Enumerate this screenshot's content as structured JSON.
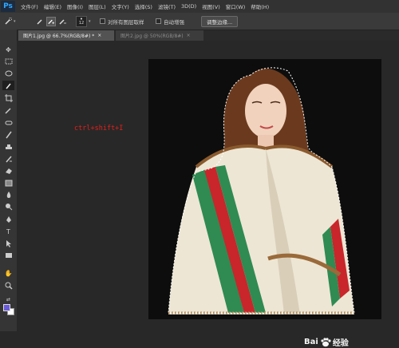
{
  "menubar": {
    "logo": "Ps",
    "items": [
      "文件(F)",
      "编辑(E)",
      "图像(I)",
      "图层(L)",
      "文字(Y)",
      "选择(S)",
      "滤镜(T)",
      "3D(D)",
      "视图(V)",
      "窗口(W)",
      "帮助(H)"
    ]
  },
  "options": {
    "brush_size": "12",
    "sample_all_layers_label": "对所有图层取样",
    "auto_enhance_label": "自动增强",
    "refine_edge_button": "调整边缘..."
  },
  "tabs": [
    {
      "label": "图片1.jpg @ 66.7%(RGB/8#) *",
      "close": "×",
      "active": true
    },
    {
      "label": "图片2.jpg @ 50%(RGB/8#)",
      "close": "×",
      "active": false
    }
  ],
  "toolbar": {
    "tools": [
      "move-tool-icon",
      "marquee-tool-icon",
      "lasso-tool-icon",
      "quick-selection-tool-icon",
      "crop-tool-icon",
      "eyedropper-tool-icon",
      "healing-brush-icon",
      "brush-tool-icon",
      "clone-stamp-icon",
      "history-brush-icon",
      "eraser-tool-icon",
      "gradient-tool-icon",
      "blur-tool-icon",
      "dodge-tool-icon",
      "pen-tool-icon",
      "type-tool-icon",
      "path-selection-icon",
      "rectangle-tool-icon",
      "hand-tool-icon",
      "zoom-tool-icon"
    ],
    "foreground_color": "#6a5bd8",
    "background_color": "#ffffff"
  },
  "canvas": {
    "annotation": "ctrl+shift+I",
    "annotation_color": "#e0211c"
  },
  "watermark": {
    "left_text": "Bai",
    "right_text": "经验"
  }
}
